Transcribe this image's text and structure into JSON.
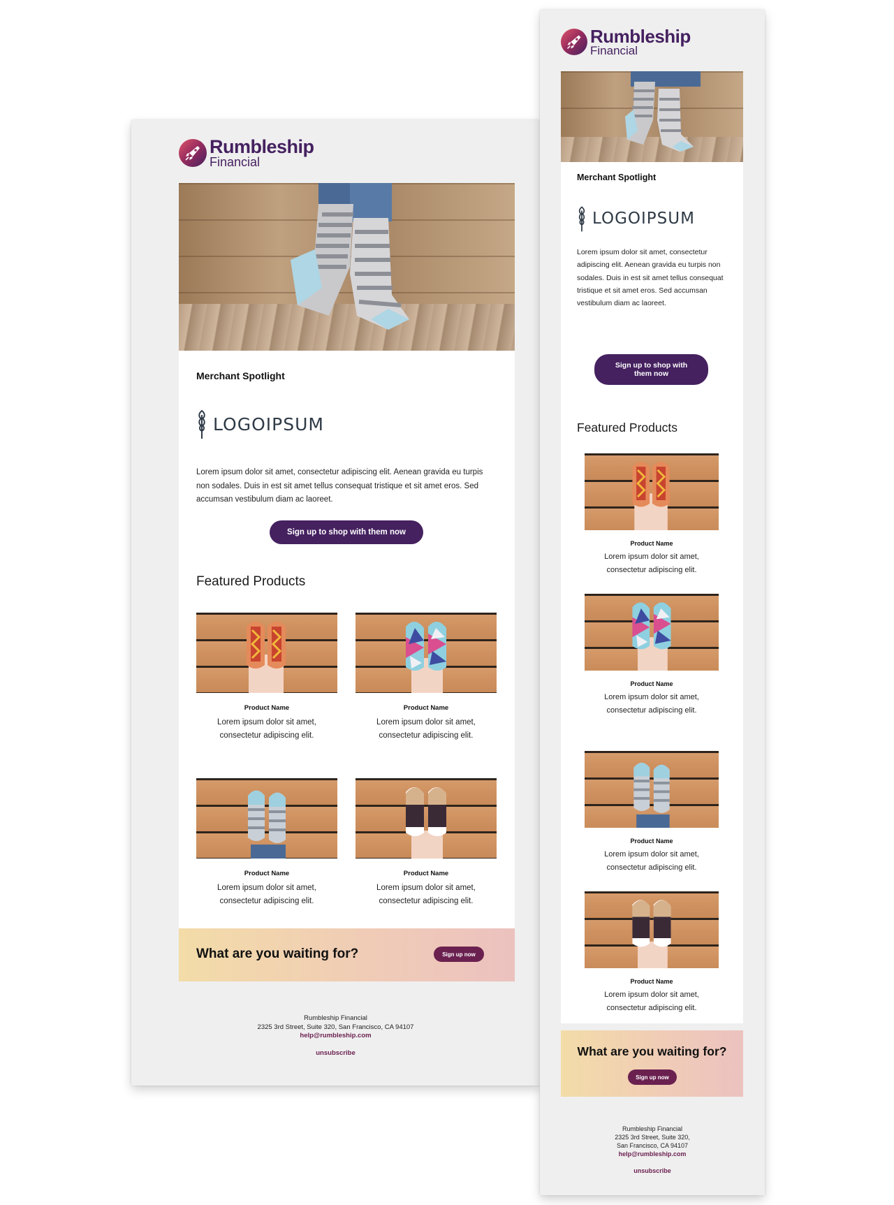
{
  "brand": {
    "name_line1": "Rumbleship",
    "name_line2": "Financial",
    "primary_color": "#452160",
    "accent_color": "#6b2150"
  },
  "spotlight": {
    "label": "Merchant Spotlight",
    "merchant_logo_text": "LOGOIPSUM",
    "body": "Lorem ipsum dolor sit amet, consectetur adipiscing elit. Aenean gravida eu turpis non sodales. Duis in est sit amet tellus consequat tristique et sit amet eros. Sed accumsan vestibulum diam ac laoreet.",
    "button_label": "Sign up to shop with them now"
  },
  "featured": {
    "title": "Featured Products",
    "products": [
      {
        "name": "Product Name",
        "description": "Lorem ipsum dolor sit amet, consectetur adipiscing elit.",
        "image_icon": "hotdog-socks-icon"
      },
      {
        "name": "Product Name",
        "description": "Lorem ipsum dolor sit amet, consectetur adipiscing elit.",
        "image_icon": "geometric-socks-icon"
      },
      {
        "name": "Product Name",
        "description": "Lorem ipsum dolor sit amet, consectetur adipiscing elit.",
        "image_icon": "cat-socks-icon"
      },
      {
        "name": "Product Name",
        "description": "Lorem ipsum dolor sit amet, consectetur adipiscing elit.",
        "image_icon": "paw-socks-icon"
      }
    ]
  },
  "cta": {
    "question": "What are you waiting for?",
    "button_label": "Sign up now"
  },
  "footer": {
    "company": "Rumbleship Financial",
    "address": "2325 3rd Street, Suite 320, San Francisco, CA 94107",
    "address_line1": "2325 3rd Street, Suite 320,",
    "address_line2": "San Francisco, CA 94107",
    "email": "help@rumbleship.com",
    "unsubscribe": "unsubscribe"
  }
}
